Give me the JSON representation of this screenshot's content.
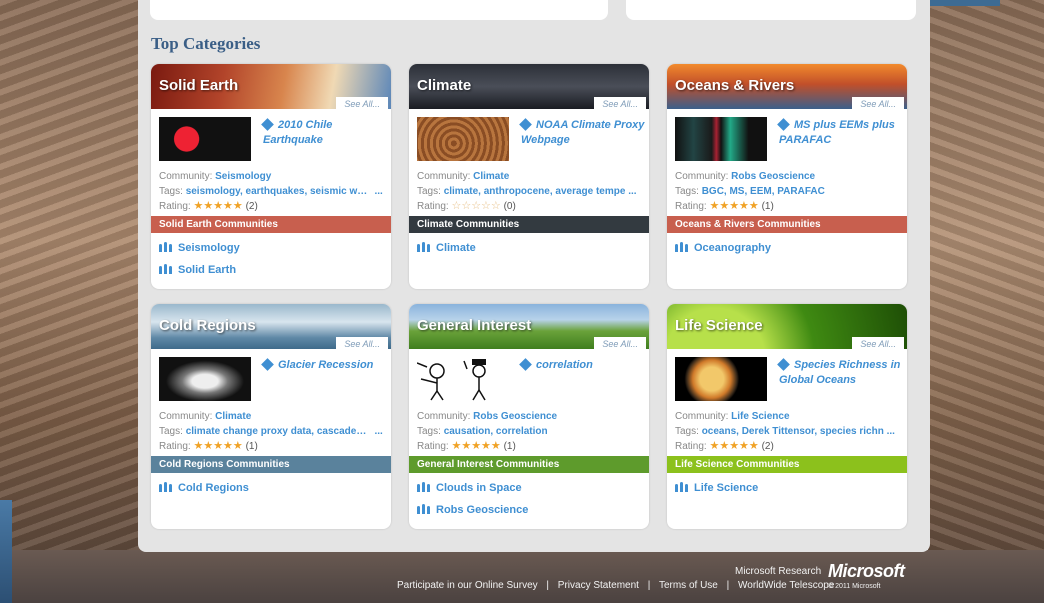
{
  "page": {
    "section_title": "Top Categories"
  },
  "categories": [
    {
      "title": "Solid Earth",
      "see_all": "See All...",
      "featured_title": "2010 Chile Earthquake",
      "community_label": "Community:",
      "community": "Seismology",
      "tags_label": "Tags:",
      "tags": "seismology, earthquakes, seismic wave",
      "rating_label": "Rating:",
      "rating_stars": "★★★★★",
      "rating_count": "(2)",
      "rating": 5,
      "communities_header": "Solid Earth Communities",
      "communities": [
        "Seismology",
        "Solid Earth"
      ],
      "bar_color": "#c85f4e"
    },
    {
      "title": "Climate",
      "see_all": "See All...",
      "featured_title": "NOAA Climate Proxy Webpage",
      "community_label": "Community:",
      "community": "Climate",
      "tags_label": "Tags:",
      "tags": "climate, anthropocene, average tempe",
      "rating_label": "Rating:",
      "rating_stars": "☆☆☆☆☆",
      "rating_count": "(0)",
      "rating": 0,
      "communities_header": "Climate Communities",
      "communities": [
        "Climate"
      ],
      "bar_color": "#333a40"
    },
    {
      "title": "Oceans & Rivers",
      "see_all": "See All...",
      "featured_title": "MS plus EEMs plus PARAFAC",
      "community_label": "Community:",
      "community": "Robs Geoscience",
      "tags_label": "Tags:",
      "tags": "BGC, MS, EEM, PARAFAC",
      "rating_label": "Rating:",
      "rating_stars": "★★★★★",
      "rating_count": "(1)",
      "rating": 5,
      "communities_header": "Oceans & Rivers Communities",
      "communities": [
        "Oceanography"
      ],
      "bar_color": "#c85f4e"
    },
    {
      "title": "Cold Regions",
      "see_all": "See All...",
      "featured_title": "Glacier Recession",
      "community_label": "Community:",
      "community": "Climate",
      "tags_label": "Tags:",
      "tags": "climate change proxy data, cascades, C",
      "rating_label": "Rating:",
      "rating_stars": "★★★★★",
      "rating_count": "(1)",
      "rating": 5,
      "communities_header": "Cold Regions Communities",
      "communities": [
        "Cold Regions"
      ],
      "bar_color": "#5a829c"
    },
    {
      "title": "General Interest",
      "see_all": "See All...",
      "featured_title": "correlation",
      "community_label": "Community:",
      "community": "Robs Geoscience",
      "tags_label": "Tags:",
      "tags": "causation, correlation",
      "rating_label": "Rating:",
      "rating_stars": "★★★★★",
      "rating_count": "(1)",
      "rating": 5,
      "communities_header": "General Interest Communities",
      "communities": [
        "Clouds in Space",
        "Robs Geoscience"
      ],
      "bar_color": "#5e9b2c"
    },
    {
      "title": "Life Science",
      "see_all": "See All...",
      "featured_title": "Species Richness in Global Oceans",
      "community_label": "Community:",
      "community": "Life Science",
      "tags_label": "Tags:",
      "tags": "oceans, Derek Tittensor, species richn",
      "rating_label": "Rating:",
      "rating_stars": "★★★★★",
      "rating_count": "(2)",
      "rating": 5,
      "communities_header": "Life Science Communities",
      "communities": [
        "Life Science"
      ],
      "bar_color": "#8cc11c"
    }
  ],
  "footer": {
    "ms_research": "Microsoft Research",
    "ms_logo": "Microsoft",
    "copyright": "© 2011 Microsoft",
    "links": [
      "Participate in our Online Survey",
      "Privacy Statement",
      "Terms of Use",
      "WorldWide Telescope"
    ],
    "separator": "|"
  }
}
